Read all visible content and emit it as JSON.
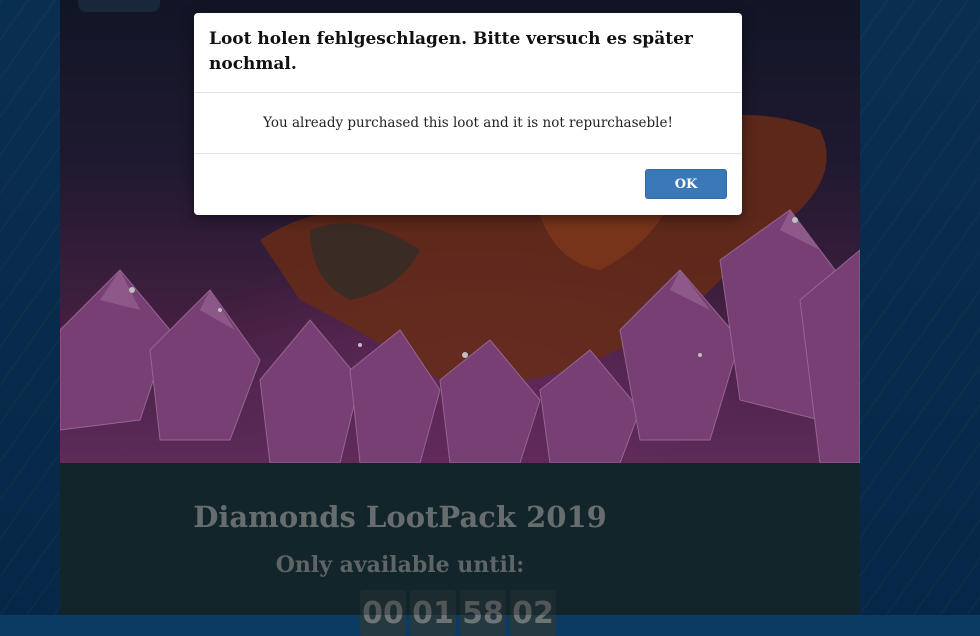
{
  "dialog": {
    "title": "Loot holen fehlgeschlagen. Bitte versuch es später nochmal.",
    "message": "You already purchased this loot and it is not repurchaseble!",
    "ok_label": "OK"
  },
  "loot_pack": {
    "title": "Diamonds LootPack 2019",
    "availability_label": "Only available until:",
    "countdown": [
      "00",
      "01",
      "58",
      "02"
    ]
  },
  "colors": {
    "page_background": "#0b3a63",
    "card_background": "#1b3438",
    "ok_button": "#3a78b8",
    "crystal": "#a0559c"
  }
}
